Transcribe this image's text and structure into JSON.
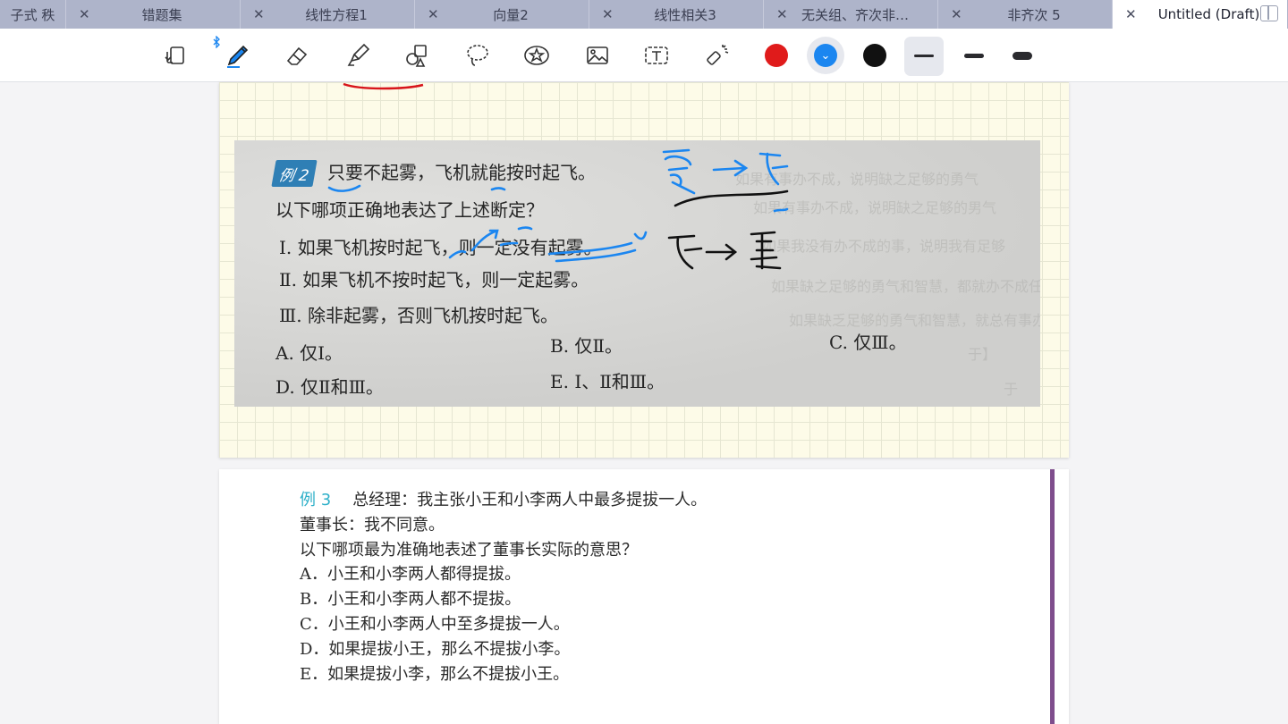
{
  "tabs": [
    {
      "label": "子式 秩"
    },
    {
      "label": "错题集"
    },
    {
      "label": "线性方程1"
    },
    {
      "label": "向量2"
    },
    {
      "label": "线性相关3"
    },
    {
      "label": "无关组、齐次非齐…"
    },
    {
      "label": "非齐次 5"
    },
    {
      "label": "Untitled (Draft)"
    }
  ],
  "toolbar": {
    "tools": [
      "page-layout-icon",
      "pen-icon",
      "eraser-icon",
      "highlighter-icon",
      "shapes-icon",
      "lasso-icon",
      "sticker-icon",
      "image-icon",
      "text-icon",
      "laser-pointer-icon"
    ],
    "colors": [
      "#e01b1b",
      "#1b86f0",
      "#111111"
    ],
    "selected_color": "#1b86f0"
  },
  "example2": {
    "badge": "例 2",
    "stem": "只要不起雾，飞机就能按时起飞。",
    "question": "以下哪项正确地表达了上述断定？",
    "statements": [
      "Ⅰ. 如果飞机按时起飞，则一定没有起雾。",
      "Ⅱ. 如果飞机不按时起飞，则一定起雾。",
      "Ⅲ. 除非起雾，否则飞机按时起飞。"
    ],
    "options": {
      "A": "A. 仅Ⅰ。",
      "B": "B. 仅Ⅱ。",
      "C": "C. 仅Ⅲ。",
      "D": "D. 仅Ⅱ和Ⅲ。",
      "E": "E. Ⅰ、Ⅱ和Ⅲ。"
    }
  },
  "example3": {
    "tag": "例 3",
    "lines": [
      "总经理：我主张小王和小李两人中最多提拔一人。",
      "董事长：我不同意。",
      "以下哪项最为准确地表述了董事长实际的意思？",
      "A．小王和小李两人都得提拔。",
      "B．小王和小李两人都不提拔。",
      "C．小王和小李两人中至多提拔一人。",
      "D．如果提拔小王，那么不提拔小李。",
      "E．如果提拔小李，那么不提拔小王。"
    ]
  },
  "ink_colors": {
    "blue": "#1b86f0",
    "black": "#111111",
    "red": "#d8151b"
  }
}
